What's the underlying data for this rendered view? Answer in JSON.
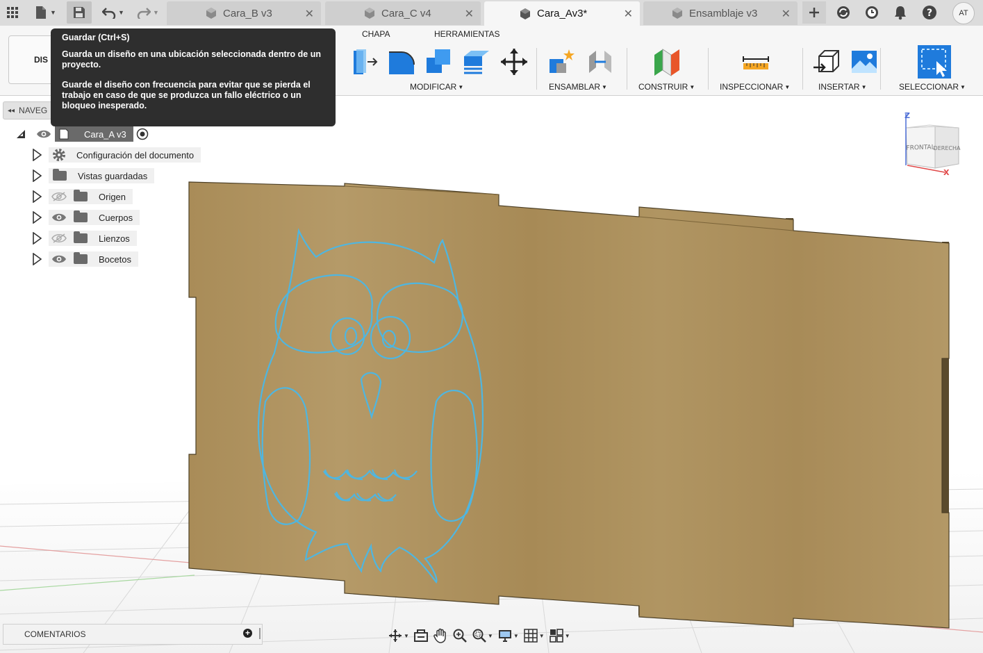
{
  "topbar": {
    "tabs": [
      {
        "label": "Cara_B v3",
        "active": false
      },
      {
        "label": "Cara_C v4",
        "active": false
      },
      {
        "label": "Cara_Av3*",
        "active": true
      },
      {
        "label": "Ensamblaje v3",
        "active": false
      }
    ],
    "close_glyph": "✕",
    "user_initials": "AT"
  },
  "ribbon": {
    "workspace_label": "DIS",
    "tabs": [
      "CHAPA",
      "HERRAMIENTAS"
    ],
    "groups": [
      "MODIFICAR",
      "ENSAMBLAR",
      "CONSTRUIR",
      "INSPECCIONAR",
      "INSERTAR",
      "SELECCIONAR"
    ],
    "dropdown_glyph": "▼"
  },
  "tooltip": {
    "title": "Guardar (Ctrl+S)",
    "paragraph1": "Guarda un diseño en una ubicación seleccionada dentro de un proyecto.",
    "paragraph2": "Guarde el diseño con frecuencia para evitar que se pierda el trabajo en caso de que se produzca un fallo eléctrico o un bloqueo inesperado."
  },
  "browser": {
    "header": "NAVEG",
    "collapse_glyph": "◂◂",
    "root": "Cara_A v3",
    "items": [
      {
        "label": "Configuración del documento",
        "icon": "gear-icon",
        "visibility": "none"
      },
      {
        "label": "Vistas guardadas",
        "icon": "folder-icon",
        "visibility": "none"
      },
      {
        "label": "Origen",
        "icon": "folder-icon",
        "visibility": "hidden"
      },
      {
        "label": "Cuerpos",
        "icon": "folder-icon",
        "visibility": "visible"
      },
      {
        "label": "Lienzos",
        "icon": "folder-icon",
        "visibility": "hidden"
      },
      {
        "label": "Bocetos",
        "icon": "folder-icon",
        "visibility": "visible"
      }
    ]
  },
  "viewcube": {
    "front": "FRONTAL",
    "right": "DERECHA",
    "axis_z": "Z",
    "axis_x": "X"
  },
  "bottom": {
    "comments_label": "COMENTARIOS",
    "add_glyph": "+"
  },
  "colors": {
    "accent": "#1a73d9",
    "wood": "#a88c5a",
    "sketch": "#4fb6e0",
    "tooltip_bg": "#2e2e2e"
  }
}
